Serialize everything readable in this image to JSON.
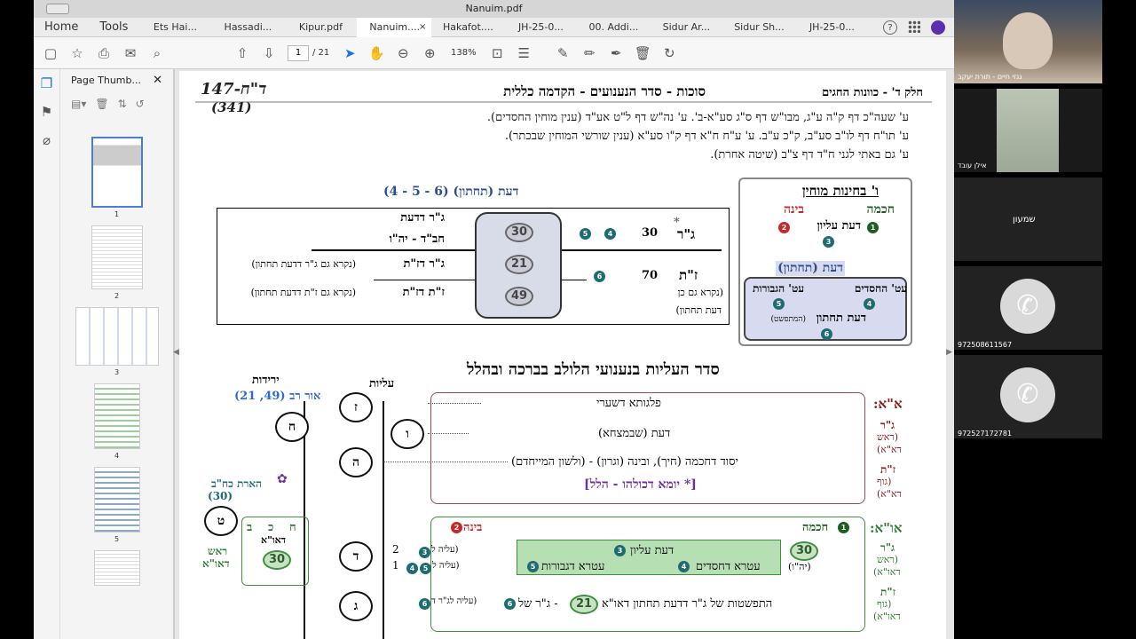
{
  "window": {
    "title": "Nanuim.pdf"
  },
  "tabs": [
    {
      "label": "Home"
    },
    {
      "label": "Tools"
    },
    {
      "label": "Ets Hai..."
    },
    {
      "label": "Hassadi..."
    },
    {
      "label": "Kipur.pdf"
    },
    {
      "label": "Nanuim....",
      "close": "×"
    },
    {
      "label": "Hakafot...."
    },
    {
      "label": "JH-25-0..."
    },
    {
      "label": "00. Addi..."
    },
    {
      "label": "Sidur Ar..."
    },
    {
      "label": "Sidur Sh..."
    },
    {
      "label": "JH-25-0..."
    }
  ],
  "topright": {
    "help": "?"
  },
  "toolbar": {
    "page_current": "1",
    "page_total": "/ 21",
    "zoom": "138%"
  },
  "thumbnails": {
    "title": "Page Thumb...",
    "close": "✕",
    "pages": [
      "1",
      "2",
      "3",
      "4",
      "5"
    ]
  },
  "doc": {
    "header_right": "חלק ד' - כוונות החגים",
    "header_mid": "סוכות - סדר הנענועים - הקדמה כללית",
    "header_left": "147-ד\"ח",
    "header_left2": "(341)",
    "sources": [
      "ע' שעה\"כ דף ק\"ה ע\"ג, מבו\"ש דף ס\"ג סע\"א-ב'. ע' נה\"ש דף ל\"ט אע\"ד (ענין מוחין החסדים).",
      "ע' תו\"ח דף לו\"ב סע\"ב, ק\"כ ע\"ב.  ע' ע\"ח ח\"א דף ק\"ו סע\"א (ענין שורשי המוחין שבכתר).",
      "ע' גם באתי לגני ח\"ד דף צ\"ב (שיטה אחרת)."
    ],
    "daat_title": "דעת (תחתון) (6 - 5 - 4)",
    "table": {
      "gar_daat": "ג\"ר דדעת",
      "chabav": "חב\"ד - יה\"ו",
      "gar_zat": "ג\"ר דז\"ת",
      "gar_zat_note": "(נקרא גם ג\"ר דדעת תחתון)",
      "zat_zat": "ז\"ת דז\"ת",
      "zat_zat_note": "(נקרא גם ז\"ת דדעת תחתון)",
      "gar": "ג\"ר",
      "star": "*",
      "gar_val": "30",
      "zat": "ז\"ת",
      "zat_val": "70",
      "zat_note1": "(נקרא גם כן",
      "zat_note2": "דעת תחתון)",
      "n30": "30",
      "n21": "21",
      "n49": "49",
      "d5": "5",
      "d4": "4",
      "d6": "6"
    },
    "mochin": {
      "title": "ו' בחינות מוחין",
      "chochma": "חכמה",
      "bina": "בינה",
      "daat_elyon": "דעת עליון",
      "d1": "1",
      "d2": "2",
      "d3": "3",
      "daat_tachton": "דעת (תחתון)",
      "atik_chasadim": "עט' החסדים",
      "atik_gevurot": "עט' הגבורות",
      "d5": "5",
      "d4": "4",
      "daat_tachton2": "דעת תחתון",
      "hitpashtut": "(המתפשט)",
      "d6": "6"
    },
    "section_title": "סדר העליות בנענועי הלולב בברכה ובהלל",
    "yeridot": "ירידות",
    "aliyot": "עליות",
    "or_rav": "אור רב (49, 21)",
    "nodes": {
      "z": "ז",
      "v": "ו",
      "h": "ה",
      "d": "ד",
      "g": "ג",
      "chet": "ח",
      "tet": "ט",
      "sub1": "1"
    },
    "harat": "הארת כח\"ב",
    "harat_val": "(30)",
    "side": {
      "h": "ח",
      "k": "כ",
      "b": "ב",
      "daoa": "דאו\"א",
      "rosh": "ראש",
      "daoa2": "דאו\"א",
      "n30": "30"
    },
    "aa": {
      "label": "א\"א:",
      "row1": "פלגותא דשערי",
      "row2": "דעת (שבמצחא)",
      "row3": "יסוד דחכמה (חיך), ובינה (וגרון) - (ולשון המייחדם)",
      "row4": "[* יומא דכולהו - הלל]",
      "gar": "ג\"ר",
      "rosh": "(ראש",
      "daa": "דא\"א)",
      "zat": "ז\"ת",
      "guf": "(גוף",
      "daa2": "דא\"א)"
    },
    "ao": {
      "label": "או\"א:",
      "chochma": "חכמה",
      "bina": "בינה",
      "d1": "1",
      "d2": "2",
      "daat_elyon": "דעת עליון",
      "d3": "3",
      "atra_chasadim": "עטרא דחסדים",
      "d4": "4",
      "atra_gevurot": "עטרא דגבורות",
      "d5": "5",
      "n30": "30",
      "yhv": "(יה\"ו)",
      "aliya1": "(עליה ל",
      "aliya2": "(עליה ל",
      "hitpashtut": "התפשטות של ג\"ר דדעת תחתון דאו\"א",
      "n21": "21",
      "gar_shel": "- ג\"ר של",
      "aliya3": "(עליה לג\"ר ד",
      "d6": "6",
      "gar": "ג\"ר",
      "rosh": "(ראש",
      "daoa": "דאו\"א)",
      "zat": "ז\"ת",
      "guf": "(גוף",
      "daoa2": "דאו\"א)",
      "c2": "2",
      "c1": "1"
    }
  },
  "participants": [
    {
      "name": "גנזי חיים - תורת יעקב"
    },
    {
      "name": "אילן עובד"
    },
    {
      "name": "שמעון"
    },
    {
      "name": "972508611567"
    },
    {
      "name": "972527172781"
    }
  ]
}
